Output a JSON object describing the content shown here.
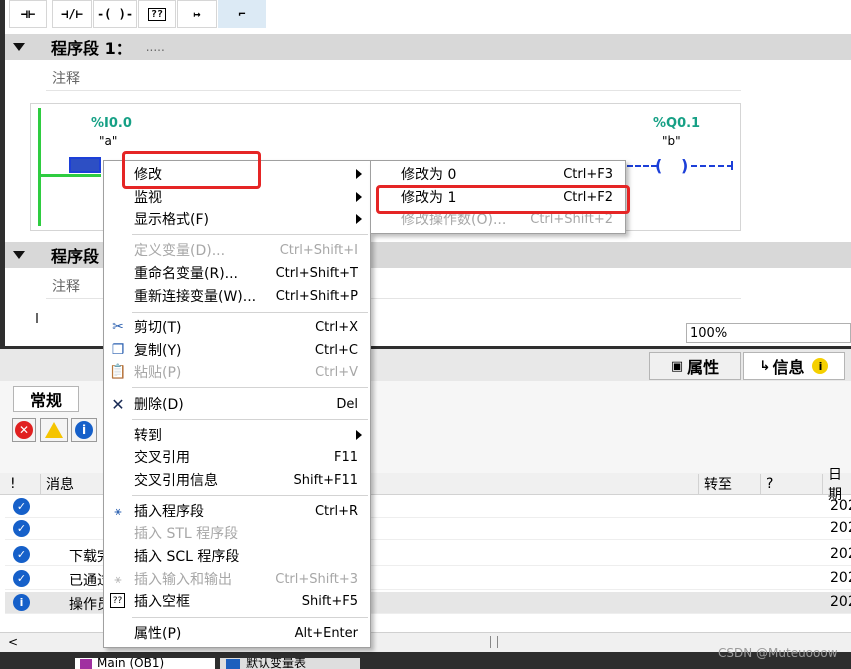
{
  "toolbar": {
    "buttons": [
      "⊣⊢",
      "⊣/⊢",
      "-(  )-",
      "??",
      "↦",
      "⌐"
    ]
  },
  "segments": [
    {
      "title": "程序段 1：",
      "dots": ".....",
      "comment": "注释"
    },
    {
      "title": "程序段",
      "comment": "注释"
    }
  ],
  "ladder": {
    "contact_addr": "%I0.0",
    "contact_sym": "\"a\"",
    "coil_addr": "%Q0.1",
    "coil_sym": "\"b\""
  },
  "context_menu": {
    "items": [
      {
        "label": "修改",
        "shortcut": "",
        "submenu": true,
        "disabled": false,
        "icon": ""
      },
      {
        "label": "监视",
        "shortcut": "",
        "submenu": true,
        "disabled": false,
        "icon": ""
      },
      {
        "label": "显示格式(F)",
        "shortcut": "",
        "submenu": true,
        "disabled": false,
        "icon": ""
      },
      {
        "label": "定义变量(D)...",
        "shortcut": "Ctrl+Shift+I",
        "submenu": false,
        "disabled": true,
        "icon": ""
      },
      {
        "label": "重命名变量(R)...",
        "shortcut": "Ctrl+Shift+T",
        "submenu": false,
        "disabled": false,
        "icon": ""
      },
      {
        "label": "重新连接变量(W)...",
        "shortcut": "Ctrl+Shift+P",
        "submenu": false,
        "disabled": false,
        "icon": ""
      },
      {
        "label": "剪切(T)",
        "shortcut": "Ctrl+X",
        "submenu": false,
        "disabled": false,
        "icon": "scissors-icon"
      },
      {
        "label": "复制(Y)",
        "shortcut": "Ctrl+C",
        "submenu": false,
        "disabled": false,
        "icon": "copy-icon"
      },
      {
        "label": "粘贴(P)",
        "shortcut": "Ctrl+V",
        "submenu": false,
        "disabled": true,
        "icon": "paste-icon"
      },
      {
        "label": "删除(D)",
        "shortcut": "Del",
        "submenu": false,
        "disabled": false,
        "icon": "delete-x-icon"
      },
      {
        "label": "转到",
        "shortcut": "",
        "submenu": true,
        "disabled": false,
        "icon": ""
      },
      {
        "label": "交叉引用",
        "shortcut": "F11",
        "submenu": false,
        "disabled": false,
        "icon": ""
      },
      {
        "label": "交叉引用信息",
        "shortcut": "Shift+F11",
        "submenu": false,
        "disabled": false,
        "icon": ""
      },
      {
        "label": "插入程序段",
        "shortcut": "Ctrl+R",
        "submenu": false,
        "disabled": false,
        "icon": "insert-network-icon"
      },
      {
        "label": "插入 STL 程序段",
        "shortcut": "",
        "submenu": false,
        "disabled": true,
        "icon": ""
      },
      {
        "label": "插入 SCL 程序段",
        "shortcut": "",
        "submenu": false,
        "disabled": false,
        "icon": ""
      },
      {
        "label": "插入输入和输出",
        "shortcut": "Ctrl+Shift+3",
        "submenu": false,
        "disabled": true,
        "icon": "insert-io-icon"
      },
      {
        "label": "插入空框",
        "shortcut": "Shift+F5",
        "submenu": false,
        "disabled": false,
        "icon": "empty-box-icon"
      },
      {
        "label": "属性(P)",
        "shortcut": "Alt+Enter",
        "submenu": false,
        "disabled": false,
        "icon": ""
      }
    ]
  },
  "submenu": {
    "items": [
      {
        "label": "修改为 0",
        "shortcut": "Ctrl+F3",
        "disabled": false
      },
      {
        "label": "修改为 1",
        "shortcut": "Ctrl+F2",
        "disabled": false
      },
      {
        "label": "修改操作数(O)...",
        "shortcut": "Ctrl+Shift+2",
        "disabled": true
      }
    ]
  },
  "zoom": "100%",
  "inspector": {
    "tab_properties": "属性",
    "tab_info": "信息",
    "tab_general": "常规"
  },
  "table": {
    "headers": [
      "!",
      "消息",
      "转至",
      "?",
      "日期"
    ],
    "rows": [
      {
        "msg": "",
        "date": "202"
      },
      {
        "msg": "",
        "date": "202"
      },
      {
        "msg": "下载完",
        "date": "202"
      },
      {
        "msg": "已通过",
        "date": "202"
      },
      {
        "msg": "操作员",
        "date": "202"
      }
    ]
  },
  "taskbar": {
    "item1": "Main (OB1)",
    "item2": "默认变量表"
  },
  "watermark": "CSDN @Muteuooow",
  "colors": {
    "highlight_red": "#e52525",
    "ladder_green": "#2ecc40",
    "wire_blue": "#1c3fd8"
  }
}
